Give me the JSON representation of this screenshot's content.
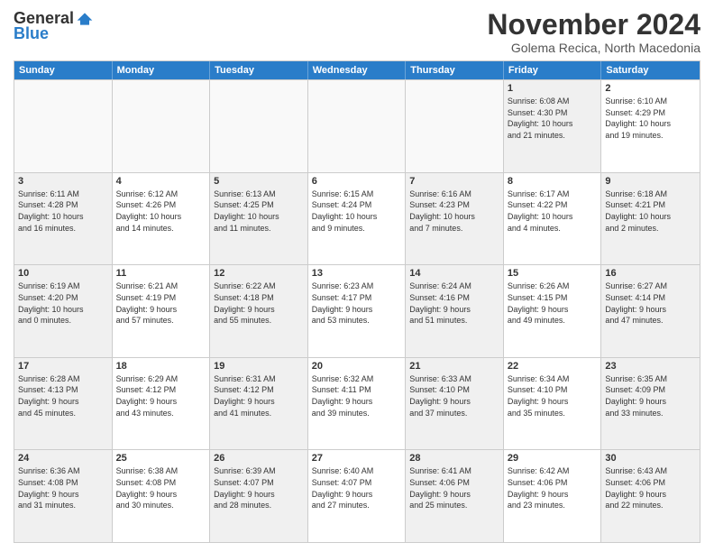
{
  "logo": {
    "general": "General",
    "blue": "Blue"
  },
  "title": "November 2024",
  "location": "Golema Recica, North Macedonia",
  "days": [
    "Sunday",
    "Monday",
    "Tuesday",
    "Wednesday",
    "Thursday",
    "Friday",
    "Saturday"
  ],
  "rows": [
    [
      {
        "day": "",
        "info": "",
        "shaded": false,
        "empty": true
      },
      {
        "day": "",
        "info": "",
        "shaded": false,
        "empty": true
      },
      {
        "day": "",
        "info": "",
        "shaded": false,
        "empty": true
      },
      {
        "day": "",
        "info": "",
        "shaded": false,
        "empty": true
      },
      {
        "day": "",
        "info": "",
        "shaded": false,
        "empty": true
      },
      {
        "day": "1",
        "info": "Sunrise: 6:08 AM\nSunset: 4:30 PM\nDaylight: 10 hours\nand 21 minutes.",
        "shaded": true,
        "empty": false
      },
      {
        "day": "2",
        "info": "Sunrise: 6:10 AM\nSunset: 4:29 PM\nDaylight: 10 hours\nand 19 minutes.",
        "shaded": false,
        "empty": false
      }
    ],
    [
      {
        "day": "3",
        "info": "Sunrise: 6:11 AM\nSunset: 4:28 PM\nDaylight: 10 hours\nand 16 minutes.",
        "shaded": true,
        "empty": false
      },
      {
        "day": "4",
        "info": "Sunrise: 6:12 AM\nSunset: 4:26 PM\nDaylight: 10 hours\nand 14 minutes.",
        "shaded": false,
        "empty": false
      },
      {
        "day": "5",
        "info": "Sunrise: 6:13 AM\nSunset: 4:25 PM\nDaylight: 10 hours\nand 11 minutes.",
        "shaded": true,
        "empty": false
      },
      {
        "day": "6",
        "info": "Sunrise: 6:15 AM\nSunset: 4:24 PM\nDaylight: 10 hours\nand 9 minutes.",
        "shaded": false,
        "empty": false
      },
      {
        "day": "7",
        "info": "Sunrise: 6:16 AM\nSunset: 4:23 PM\nDaylight: 10 hours\nand 7 minutes.",
        "shaded": true,
        "empty": false
      },
      {
        "day": "8",
        "info": "Sunrise: 6:17 AM\nSunset: 4:22 PM\nDaylight: 10 hours\nand 4 minutes.",
        "shaded": false,
        "empty": false
      },
      {
        "day": "9",
        "info": "Sunrise: 6:18 AM\nSunset: 4:21 PM\nDaylight: 10 hours\nand 2 minutes.",
        "shaded": true,
        "empty": false
      }
    ],
    [
      {
        "day": "10",
        "info": "Sunrise: 6:19 AM\nSunset: 4:20 PM\nDaylight: 10 hours\nand 0 minutes.",
        "shaded": true,
        "empty": false
      },
      {
        "day": "11",
        "info": "Sunrise: 6:21 AM\nSunset: 4:19 PM\nDaylight: 9 hours\nand 57 minutes.",
        "shaded": false,
        "empty": false
      },
      {
        "day": "12",
        "info": "Sunrise: 6:22 AM\nSunset: 4:18 PM\nDaylight: 9 hours\nand 55 minutes.",
        "shaded": true,
        "empty": false
      },
      {
        "day": "13",
        "info": "Sunrise: 6:23 AM\nSunset: 4:17 PM\nDaylight: 9 hours\nand 53 minutes.",
        "shaded": false,
        "empty": false
      },
      {
        "day": "14",
        "info": "Sunrise: 6:24 AM\nSunset: 4:16 PM\nDaylight: 9 hours\nand 51 minutes.",
        "shaded": true,
        "empty": false
      },
      {
        "day": "15",
        "info": "Sunrise: 6:26 AM\nSunset: 4:15 PM\nDaylight: 9 hours\nand 49 minutes.",
        "shaded": false,
        "empty": false
      },
      {
        "day": "16",
        "info": "Sunrise: 6:27 AM\nSunset: 4:14 PM\nDaylight: 9 hours\nand 47 minutes.",
        "shaded": true,
        "empty": false
      }
    ],
    [
      {
        "day": "17",
        "info": "Sunrise: 6:28 AM\nSunset: 4:13 PM\nDaylight: 9 hours\nand 45 minutes.",
        "shaded": true,
        "empty": false
      },
      {
        "day": "18",
        "info": "Sunrise: 6:29 AM\nSunset: 4:12 PM\nDaylight: 9 hours\nand 43 minutes.",
        "shaded": false,
        "empty": false
      },
      {
        "day": "19",
        "info": "Sunrise: 6:31 AM\nSunset: 4:12 PM\nDaylight: 9 hours\nand 41 minutes.",
        "shaded": true,
        "empty": false
      },
      {
        "day": "20",
        "info": "Sunrise: 6:32 AM\nSunset: 4:11 PM\nDaylight: 9 hours\nand 39 minutes.",
        "shaded": false,
        "empty": false
      },
      {
        "day": "21",
        "info": "Sunrise: 6:33 AM\nSunset: 4:10 PM\nDaylight: 9 hours\nand 37 minutes.",
        "shaded": true,
        "empty": false
      },
      {
        "day": "22",
        "info": "Sunrise: 6:34 AM\nSunset: 4:10 PM\nDaylight: 9 hours\nand 35 minutes.",
        "shaded": false,
        "empty": false
      },
      {
        "day": "23",
        "info": "Sunrise: 6:35 AM\nSunset: 4:09 PM\nDaylight: 9 hours\nand 33 minutes.",
        "shaded": true,
        "empty": false
      }
    ],
    [
      {
        "day": "24",
        "info": "Sunrise: 6:36 AM\nSunset: 4:08 PM\nDaylight: 9 hours\nand 31 minutes.",
        "shaded": true,
        "empty": false
      },
      {
        "day": "25",
        "info": "Sunrise: 6:38 AM\nSunset: 4:08 PM\nDaylight: 9 hours\nand 30 minutes.",
        "shaded": false,
        "empty": false
      },
      {
        "day": "26",
        "info": "Sunrise: 6:39 AM\nSunset: 4:07 PM\nDaylight: 9 hours\nand 28 minutes.",
        "shaded": true,
        "empty": false
      },
      {
        "day": "27",
        "info": "Sunrise: 6:40 AM\nSunset: 4:07 PM\nDaylight: 9 hours\nand 27 minutes.",
        "shaded": false,
        "empty": false
      },
      {
        "day": "28",
        "info": "Sunrise: 6:41 AM\nSunset: 4:06 PM\nDaylight: 9 hours\nand 25 minutes.",
        "shaded": true,
        "empty": false
      },
      {
        "day": "29",
        "info": "Sunrise: 6:42 AM\nSunset: 4:06 PM\nDaylight: 9 hours\nand 23 minutes.",
        "shaded": false,
        "empty": false
      },
      {
        "day": "30",
        "info": "Sunrise: 6:43 AM\nSunset: 4:06 PM\nDaylight: 9 hours\nand 22 minutes.",
        "shaded": true,
        "empty": false
      }
    ]
  ]
}
